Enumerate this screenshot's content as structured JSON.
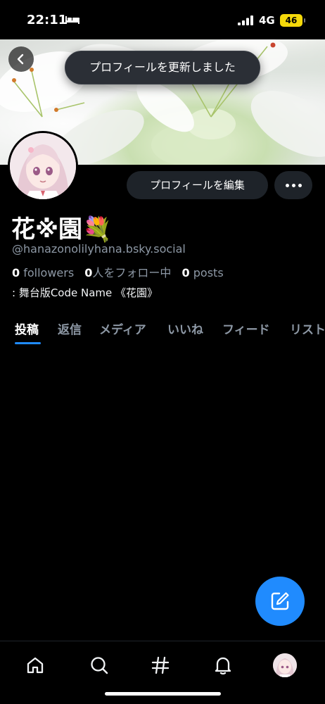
{
  "status_bar": {
    "time": "22:11",
    "network": "4G",
    "battery": "46"
  },
  "toast": "プロフィールを更新しました",
  "profile": {
    "display_name": "花※園💐",
    "handle": "@hanazonolilyhana.bsky.social",
    "followers_count": "0",
    "followers_label": "followers",
    "following_count": "0",
    "following_label": "人をフォロー中",
    "posts_count": "0",
    "posts_label": "posts",
    "bio": ": 舞台版Code Name 《花園》"
  },
  "buttons": {
    "edit_profile": "プロフィールを編集"
  },
  "tabs": [
    {
      "label": "投稿",
      "active": true
    },
    {
      "label": "返信"
    },
    {
      "label": "メディア"
    },
    {
      "label": "いいね"
    },
    {
      "label": "フィード"
    },
    {
      "label": "リスト"
    }
  ],
  "icons": {
    "back": "chevron-left-icon",
    "more": "ellipsis-icon",
    "compose": "compose-icon",
    "nav": [
      "home-icon",
      "search-icon",
      "hashtag-icon",
      "bell-icon",
      "profile-avatar"
    ]
  },
  "colors": {
    "accent": "#208bfe",
    "background": "#000000",
    "muted_text": "#8d98a5",
    "battery": "#f5d90a"
  }
}
